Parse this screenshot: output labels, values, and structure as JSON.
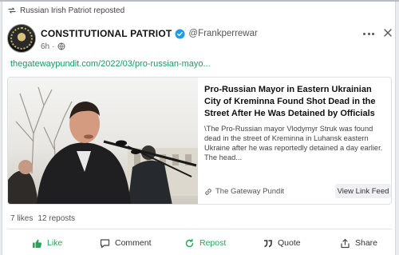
{
  "repost_bar": {
    "icon": "repost-icon",
    "text": "Russian Irish Patriot reposted"
  },
  "author": {
    "name": "CONSTITUTIONAL PATRIOT",
    "handle": "@Frankperrewar",
    "time": "6h",
    "separator": "·",
    "verified_icon": "verified-check-icon",
    "visibility_icon": "public-globe-icon"
  },
  "post": {
    "link_text": "thegatewaypundit.com/2022/03/pro-russian-mayo..."
  },
  "link_card": {
    "title": "Pro-Russian Mayor in Eastern Ukrainian City of Kreminna Found Shot Dead in the Street After He Was Detained by Officials",
    "description": "\\The Pro-Russian mayor Vlodymyr Struk was found dead in the street of Kreminna in Luhansk eastern Ukraine after he was reportedly detained a day earlier. The head...",
    "source": "The Gateway Pundit",
    "view_button": "View Link Feed"
  },
  "stats": {
    "likes": "7 likes",
    "reposts": "12 reposts"
  },
  "actions": {
    "like": "Like",
    "comment": "Comment",
    "repost": "Repost",
    "quote": "Quote",
    "share": "Share"
  },
  "colors": {
    "accent_green": "#2aa35a",
    "link_green": "#1a9a66",
    "verified_blue": "#1d9bf0"
  }
}
